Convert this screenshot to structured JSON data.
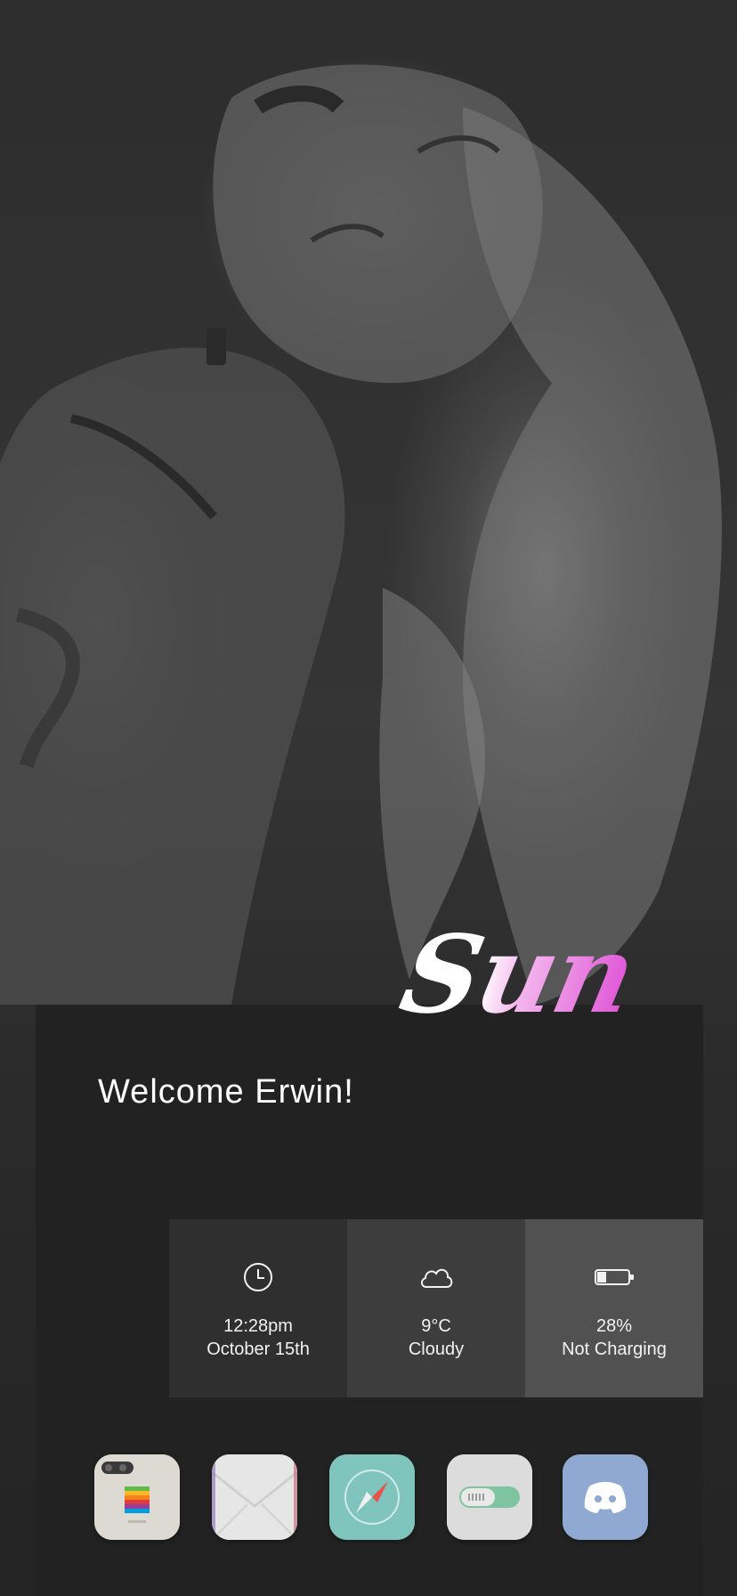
{
  "wallpaper": {
    "description_icon": "portrait-photo"
  },
  "brand": {
    "text": "Sun",
    "colors": [
      "#ffffff",
      "#e05ad8"
    ]
  },
  "welcome": {
    "text": "Welcome Erwin!"
  },
  "widgets": {
    "time": {
      "icon": "clock-icon",
      "line1": "12:28pm",
      "line2": "October 15th"
    },
    "weather": {
      "icon": "cloud-icon",
      "line1": "9°C",
      "line2": "Cloudy"
    },
    "battery": {
      "icon": "battery-icon",
      "line1": "28%",
      "line2": "Not Charging",
      "level": 0.28
    }
  },
  "dock": {
    "apps": [
      {
        "icon": "phone-icon",
        "color": "#dcdad2"
      },
      {
        "icon": "mail-icon",
        "color": "#e4e4e4"
      },
      {
        "icon": "safari-icon",
        "color": "#7fc4bd"
      },
      {
        "icon": "settings-toggle-icon",
        "color": "#dcdcdc"
      },
      {
        "icon": "discord-icon",
        "color": "#8fa9d2"
      }
    ]
  }
}
